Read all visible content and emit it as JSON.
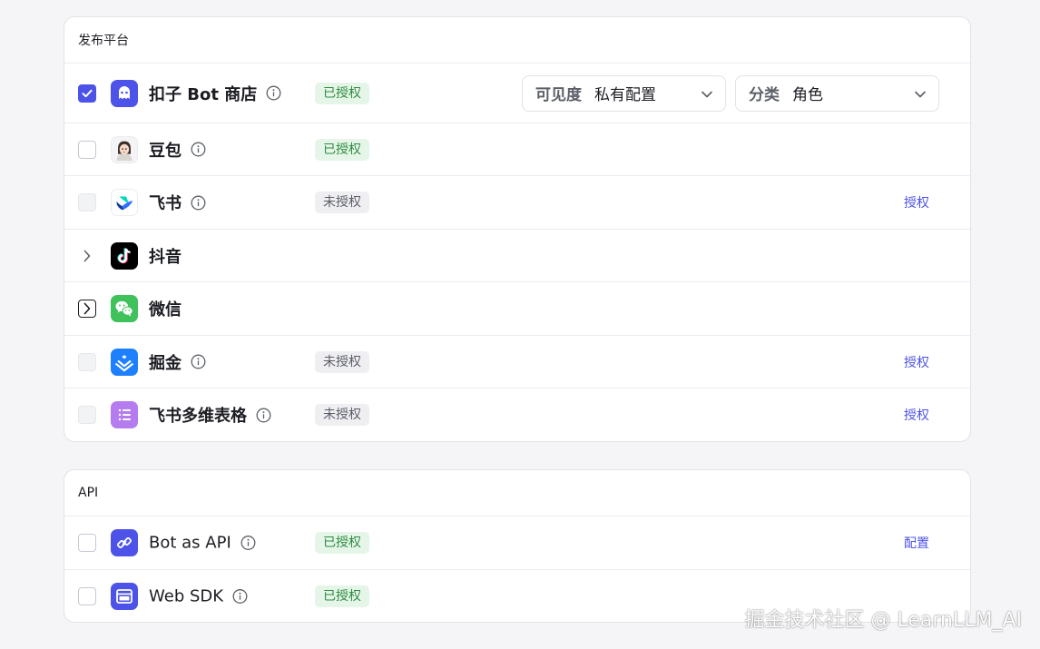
{
  "publish": {
    "title": "发布平台",
    "rows": [
      {
        "name": "扣子 Bot 商店",
        "status": "已授权",
        "action": ""
      },
      {
        "name": "豆包",
        "status": "已授权",
        "action": ""
      },
      {
        "name": "飞书",
        "status": "未授权",
        "action": "授权"
      },
      {
        "name": "抖音"
      },
      {
        "name": "微信"
      },
      {
        "name": "掘金",
        "status": "未授权",
        "action": "授权"
      },
      {
        "name": "飞书多维表格",
        "status": "未授权",
        "action": "授权"
      }
    ],
    "visibility_select": {
      "label": "可见度",
      "value": "私有配置"
    },
    "category_select": {
      "label": "分类",
      "value": "角色"
    }
  },
  "api": {
    "title": "API",
    "rows": [
      {
        "name": "Bot as API",
        "status": "已授权",
        "action": "配置"
      },
      {
        "name": "Web SDK",
        "status": "已授权",
        "action": ""
      }
    ]
  },
  "watermark": "掘金技术社区 @ LearnLLM_AI",
  "colors": {
    "accent": "#4d53e8",
    "authorized_bg": "#e5f6e8",
    "authorized_text": "#2f8b43",
    "unauthorized_bg": "#efeff2"
  },
  "icons": {
    "coze": "coze-store-icon",
    "doubao": "doubao-avatar-icon",
    "feishu": "feishu-icon",
    "douyin": "douyin-icon",
    "wechat": "wechat-icon",
    "juejin": "juejin-icon",
    "bitable": "feishu-bitable-icon",
    "api": "bot-api-icon",
    "sdk": "web-sdk-icon"
  }
}
